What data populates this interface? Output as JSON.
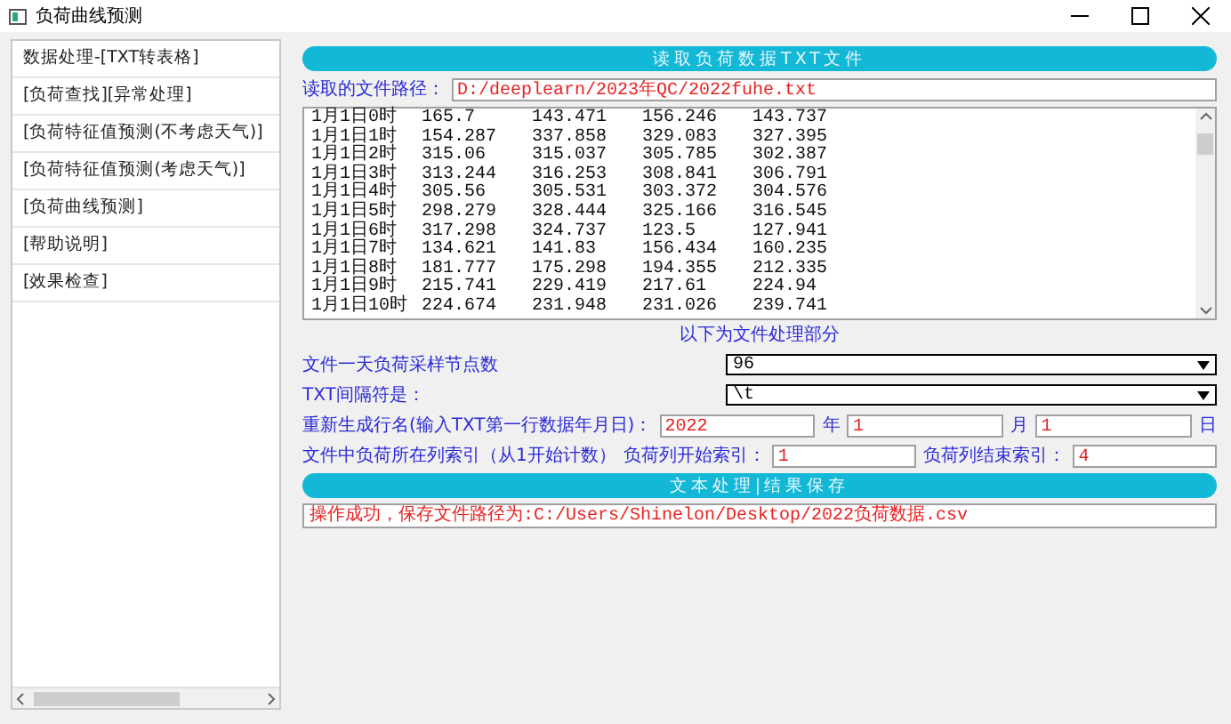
{
  "window": {
    "title": "负荷曲线预测"
  },
  "sidebar": {
    "items": [
      {
        "label": "数据处理-[TXT转表格]"
      },
      {
        "label": "[负荷查找][异常处理]"
      },
      {
        "label": "[负荷特征值预测(不考虑天气)]"
      },
      {
        "label": "[负荷特征值预测(考虑天气)]"
      },
      {
        "label": "[负荷曲线预测]"
      },
      {
        "label": "[帮助说明]"
      },
      {
        "label": "[效果检查]"
      }
    ]
  },
  "read_button": {
    "label": "读取负荷数据TXT文件"
  },
  "file_path": {
    "label": "读取的文件路径：",
    "value": "D:/deeplearn/2023年QC/2022fuhe.txt"
  },
  "file_content": {
    "rows": [
      [
        "1月1日0时",
        "165.7",
        "143.471",
        "156.246",
        "143.737"
      ],
      [
        "1月1日1时",
        "154.287",
        "337.858",
        "329.083",
        "327.395"
      ],
      [
        "1月1日2时",
        "315.06",
        "315.037",
        "305.785",
        "302.387"
      ],
      [
        "1月1日3时",
        "313.244",
        "316.253",
        "308.841",
        "306.791"
      ],
      [
        "1月1日4时",
        "305.56",
        "305.531",
        "303.372",
        "304.576"
      ],
      [
        "1月1日5时",
        "298.279",
        "328.444",
        "325.166",
        "316.545"
      ],
      [
        "1月1日6时",
        "317.298",
        "324.737",
        "123.5",
        "127.941"
      ],
      [
        "1月1日7时",
        "134.621",
        "141.83",
        "156.434",
        "160.235"
      ],
      [
        "1月1日8时",
        "181.777",
        "175.298",
        "194.355",
        "212.335"
      ],
      [
        "1月1日9时",
        "215.741",
        "229.419",
        "217.61",
        "224.94"
      ],
      [
        "1月1日10时",
        "224.674",
        "231.948",
        "231.026",
        "239.741"
      ]
    ]
  },
  "section_caption": "以下为文件处理部分",
  "sample_points": {
    "label": "文件一天负荷采样节点数",
    "value": "96"
  },
  "delimiter": {
    "label": "TXT间隔符是：",
    "value": "\\t"
  },
  "row_name": {
    "label": "重新生成行名(输入TXT第一行数据年月日)：",
    "year": "2022",
    "year_unit": "年",
    "month": "1",
    "month_unit": "月",
    "day": "1",
    "day_unit": "日"
  },
  "column_index": {
    "label": "文件中负荷所在列索引（从1开始计数）",
    "start_label": "负荷列开始索引：",
    "start": "1",
    "end_label": "负荷列结束索引：",
    "end": "4"
  },
  "save_button": {
    "label": "文本处理|结果保存"
  },
  "status": "操作成功，保存文件路径为:C:/Users/Shinelon/Desktop/2022负荷数据.csv"
}
